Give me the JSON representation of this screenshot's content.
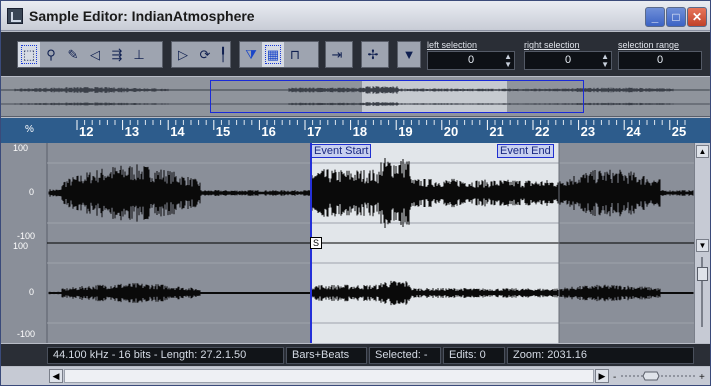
{
  "window": {
    "title": "Sample Editor: IndianAtmosphere"
  },
  "toolbar": {
    "tools": [
      {
        "name": "range-selection-tool",
        "glyph": "⬚"
      },
      {
        "name": "zoom-tool",
        "glyph": "🔍"
      },
      {
        "name": "draw-tool",
        "glyph": "✎"
      },
      {
        "name": "play-tool",
        "glyph": "🔈"
      },
      {
        "name": "scrub-tool",
        "glyph": "⇶"
      },
      {
        "name": "snap-tool",
        "glyph": "⊥"
      }
    ],
    "left_selection": {
      "label": "left selection",
      "value": "0"
    },
    "right_selection": {
      "label": "right selection",
      "value": "0"
    },
    "selection_range": {
      "label": "selection range",
      "value": "0"
    }
  },
  "ruler": {
    "unit": "%",
    "ticks": [
      "12",
      "13",
      "14",
      "15",
      "16",
      "17",
      "18",
      "19",
      "20",
      "21",
      "22",
      "23",
      "24",
      "25"
    ]
  },
  "amplitude_labels": {
    "top_100": "100",
    "top_0": "0",
    "top_m100": "-100",
    "bottom_100": "100",
    "bottom_0": "0",
    "bottom_m100": "-100"
  },
  "events": {
    "start_label": "Event Start",
    "end_label": "Event End",
    "snap_label": "S"
  },
  "status": {
    "format": "44.100 kHz - 16 bits - Length:  27.2.1.50",
    "time_format": "Bars+Beats",
    "selected": "Selected: -",
    "edits": "Edits: 0",
    "zoom": "Zoom: 2031.16"
  },
  "colors": {
    "waveform": "#0a0a0a",
    "event_region": "#e2e6ea",
    "ruler": "#2d5c8c",
    "cursor": "#2430d8"
  }
}
